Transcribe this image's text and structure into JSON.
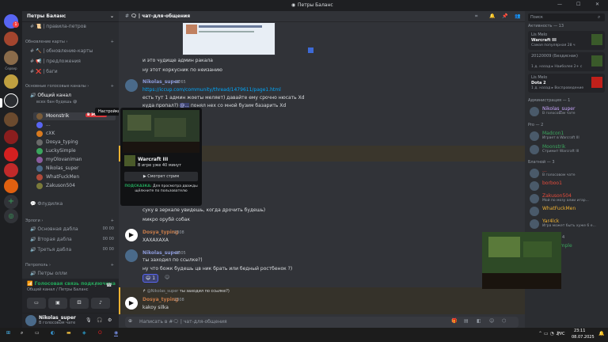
{
  "window": {
    "title": "Петры Баланс"
  },
  "servers": {
    "badge": "1",
    "item_label": "Сервер"
  },
  "sidebar": {
    "server_name": "Петры Баланс",
    "channels_top": [
      {
        "icon": "📜",
        "label": "правила-петров"
      }
    ],
    "cat_updates": "Обновление карты",
    "updates": [
      {
        "icon": "🔨",
        "label": "обновление-карты"
      },
      {
        "icon": "📢",
        "label": "предложения"
      },
      {
        "icon": "❌",
        "label": "баги"
      }
    ],
    "cat_voice": "Основные голосовые каналы",
    "voice_channel": "Общий канал",
    "voice_sub": "всех бан будешь 😅",
    "tooltip": "Настройки",
    "voice_users": [
      {
        "name": "Moonstrik",
        "badge": "В ЭФИРЕ",
        "color": "#7a5c3a"
      },
      {
        "name": "...",
        "badge": "",
        "color": "#5865f2"
      },
      {
        "name": "cXK",
        "badge": "",
        "color": "#d97a1e"
      },
      {
        "name": "Dosya_typing",
        "badge": "",
        "color": "#6a6a6a"
      },
      {
        "name": "LuckySimple",
        "badge": "",
        "color": "#3ba55d"
      },
      {
        "name": "myOlovaniman",
        "badge": "",
        "color": "#8a5c9e"
      },
      {
        "name": "Nikolas_super",
        "badge": "",
        "color": "#4a6a8a"
      },
      {
        "name": "WhatFuckMen",
        "badge": "",
        "color": "#b04a3a"
      },
      {
        "name": "Zakuson504",
        "badge": "",
        "color": "#7a7a3a"
      }
    ],
    "flood": "Флудилка",
    "cat_ranked": "Эрлоги",
    "ranked": [
      {
        "label": "Основная дабла",
        "a": "00",
        "b": "00"
      },
      {
        "label": "Вторая дабла",
        "a": "00",
        "b": "00"
      },
      {
        "label": "Третья дабла",
        "a": "00",
        "b": "00"
      }
    ],
    "cat_petrs": "Петрополь",
    "petrs": [
      "Петры олли"
    ],
    "voice_status": "Голосовая связь подключена",
    "voice_loc": "Общий канал / Петры Баланс",
    "user_name": "Nikolas_super",
    "user_status": "В голосовом чате"
  },
  "chat": {
    "channel": "чат-для-общения",
    "msgs": [
      {
        "text": "и это чудище админ ракала"
      },
      {
        "text": "ну этот коркусник по неизанию"
      }
    ],
    "m1": {
      "author": "Nikolas_super",
      "time": "2265",
      "link": "https://iccup.com/community/thread/1479611/page1.html",
      "l2": "есть тут 1 админ жоеты меляет) давайте ему срочно нюсать Xd",
      "l3a": "куда пропал?)",
      "mention": "@...",
      "l3b": "понял нех со мной бузим базарить Xd"
    },
    "stream": {
      "game": "Warcraft III",
      "sub": "В игре уже 40 минут",
      "watch": "Смотрет стрим",
      "hint_label": "ПОДСКАЗКА:",
      "hint": "Для просмотра дважды щёлкните по пользователю"
    },
    "m2": {
      "l1": "суку в зеркале увидешь, когда дрочить будешь)",
      "l2": "микро орубй собак"
    },
    "m3": {
      "author": "Dosya_typing",
      "time": "2308",
      "text": "ХАХАХАХА"
    },
    "m4": {
      "author": "Nikolas_super",
      "time": "2305",
      "l1": "ты заходил по ссылке?)",
      "l2": "ну что божк будешь цв ник брать или бедный ростбенок ?)",
      "reaction": "😄",
      "count": "1"
    },
    "reply": {
      "ref_author": "@Nikolas_super",
      "ref_text": "ты заходил по ссылке?)",
      "author": "Dosya_typing",
      "time": "2308",
      "text": "kakoy silka"
    },
    "input_placeholder": "Написать в #🗨 | чат-для-общения"
  },
  "search": {
    "placeholder": "Поиск"
  },
  "members": {
    "activity_header": "Активность — 13",
    "cards": [
      {
        "name": "Lis Melo",
        "game": "Warcraft III",
        "sub": "Самая популярная 28 ч"
      },
      {
        "name": "20120009 (Бездиснак)",
        "game": "",
        "sub": "1 д. назад ▸ Наиболее 2+ с"
      },
      {
        "name": "Lis Melo",
        "game": "Dota 2",
        "sub": "1 д. назад ▸ Воспроведение"
      }
    ],
    "admin_header": "Администрация — 1",
    "admins": [
      {
        "name": "Nikolas_super",
        "sub": "В голосовом чате",
        "color": "#c9a6ff"
      }
    ],
    "pro_header": "Pro — 2",
    "pros": [
      {
        "name": "Madcon1",
        "sub": "Играет в Warcraft III",
        "color": "#3ba55d"
      },
      {
        "name": "Moonstrik",
        "sub": "Стримит Warcraft III",
        "color": "#3ba55d"
      }
    ],
    "bl_header": "Блатной — 3",
    "bl": [
      {
        "name": "...",
        "sub": "В голосовом чате",
        "color": "#e74c3c"
      },
      {
        "name": "borboo1",
        "sub": "",
        "color": "#e74c3c"
      },
      {
        "name": "Zakuson504",
        "sub": "Мой по мозу алии игар...",
        "color": "#e74c3c"
      }
    ],
    "others": [
      {
        "name": "WhatFuckMen",
        "sub": "",
        "color": "#f0b232"
      },
      {
        "name": "Yar4lck",
        "sub": "Игра может быть хуже 6 е...",
        "color": "#f0b232"
      }
    ],
    "new_header": "Начинающий — 4",
    "newm": [
      {
        "name": "LuckySimple",
        "color": "#3ba55d"
      }
    ]
  },
  "taskbar": {
    "lang": "РУС",
    "time": "23:11",
    "date": "08.07.2025"
  }
}
